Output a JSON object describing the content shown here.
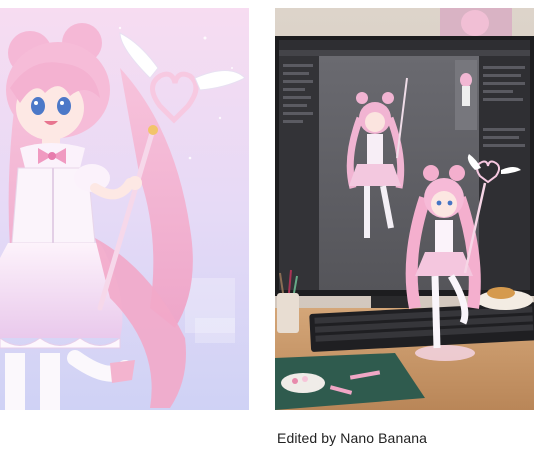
{
  "caption": "Edited by Nano Banana",
  "images": {
    "left": {
      "subject": "anime-magical-girl-illustration-icon"
    },
    "right": {
      "subject": "figure-on-desk-with-3d-modeling-monitor-icon"
    }
  },
  "colors": {
    "hair_pink": "#f4b6d3",
    "dress_white": "#fbf4fb",
    "lavender_bg": "#d9d2f2",
    "monitor_dark": "#2a2a2c",
    "desk_wood": "#c99a6c",
    "wall": "#dad2c8"
  }
}
